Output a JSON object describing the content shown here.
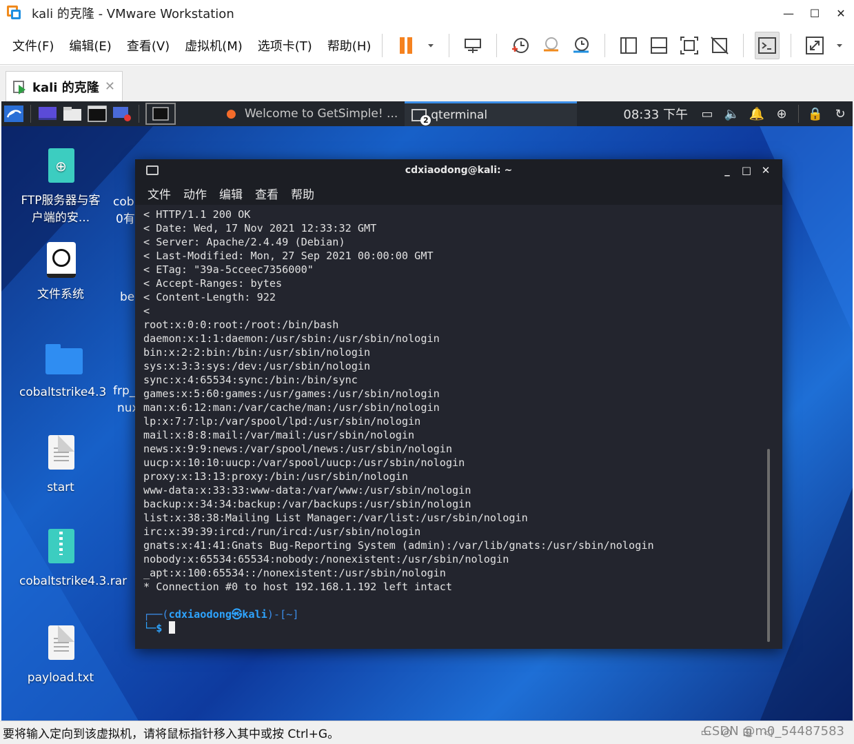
{
  "window": {
    "title": "kali 的克隆 - VMware Workstation"
  },
  "menu": [
    "文件(F)",
    "编辑(E)",
    "查看(V)",
    "虚拟机(M)",
    "选项卡(T)",
    "帮助(H)"
  ],
  "tab": {
    "label": "kali 的克隆"
  },
  "panel": {
    "tasks": [
      "Welcome to GetSimple! ...",
      "qterminal"
    ],
    "task_badge": "2",
    "clock": "08:33 下午"
  },
  "desktop": {
    "icons": [
      {
        "label": "FTP服务器与客户端的安..."
      },
      {
        "label": "文件系统"
      },
      {
        "label": "cobaltstrike4.3"
      },
      {
        "label": "start"
      },
      {
        "label": "cobaltstrike4.3.rar"
      },
      {
        "label": "payload.txt"
      }
    ],
    "partials": [
      "cob",
      "0有",
      "be",
      "frp_",
      "nux"
    ]
  },
  "terminal": {
    "title": "cdxiaodong@kali: ~",
    "menu": [
      "文件",
      "动作",
      "编辑",
      "查看",
      "帮助"
    ],
    "lines": [
      "< HTTP/1.1 200 OK",
      "< Date: Wed, 17 Nov 2021 12:33:32 GMT",
      "< Server: Apache/2.4.49 (Debian)",
      "< Last-Modified: Mon, 27 Sep 2021 00:00:00 GMT",
      "< ETag: \"39a-5cceec7356000\"",
      "< Accept-Ranges: bytes",
      "< Content-Length: 922",
      "<",
      "root:x:0:0:root:/root:/bin/bash",
      "daemon:x:1:1:daemon:/usr/sbin:/usr/sbin/nologin",
      "bin:x:2:2:bin:/bin:/usr/sbin/nologin",
      "sys:x:3:3:sys:/dev:/usr/sbin/nologin",
      "sync:x:4:65534:sync:/bin:/bin/sync",
      "games:x:5:60:games:/usr/games:/usr/sbin/nologin",
      "man:x:6:12:man:/var/cache/man:/usr/sbin/nologin",
      "lp:x:7:7:lp:/var/spool/lpd:/usr/sbin/nologin",
      "mail:x:8:8:mail:/var/mail:/usr/sbin/nologin",
      "news:x:9:9:news:/var/spool/news:/usr/sbin/nologin",
      "uucp:x:10:10:uucp:/var/spool/uucp:/usr/sbin/nologin",
      "proxy:x:13:13:proxy:/bin:/usr/sbin/nologin",
      "www-data:x:33:33:www-data:/var/www:/usr/sbin/nologin",
      "backup:x:34:34:backup:/var/backups:/usr/sbin/nologin",
      "list:x:38:38:Mailing List Manager:/var/list:/usr/sbin/nologin",
      "irc:x:39:39:ircd:/run/ircd:/usr/sbin/nologin",
      "gnats:x:41:41:Gnats Bug-Reporting System (admin):/var/lib/gnats:/usr/sbin/nologin",
      "nobody:x:65534:65534:nobody:/nonexistent:/usr/sbin/nologin",
      "_apt:x:100:65534::/nonexistent:/usr/sbin/nologin",
      "* Connection #0 to host 192.168.1.192 left intact"
    ],
    "prompt": {
      "open": "┌──(",
      "user": "cdxiaodong㉿kali",
      "close": ")-[~]",
      "line2": "└─$ "
    }
  },
  "statusbar": {
    "message": "要将输入定向到该虚拟机，请将鼠标指针移入其中或按 Ctrl+G。",
    "watermark": "CSDN @m0_54487583"
  },
  "colors": {
    "accent": "#3b8ee8",
    "terminal_bg": "#23252e",
    "prompt": "#2ea4ff"
  }
}
